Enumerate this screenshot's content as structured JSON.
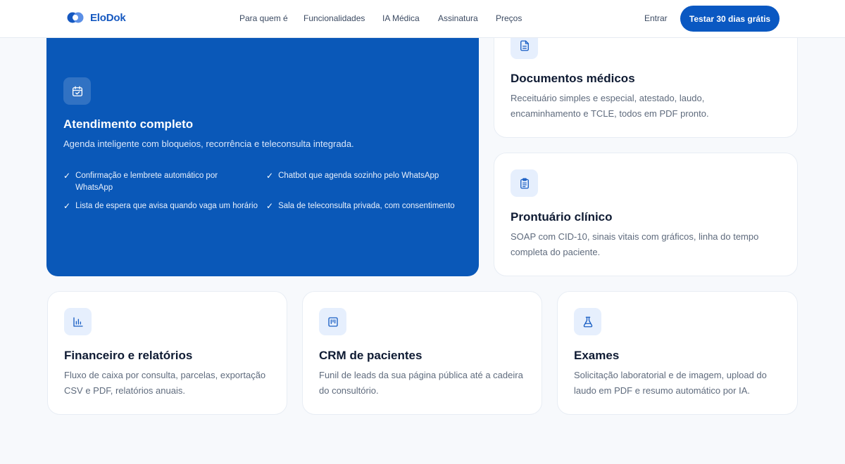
{
  "header": {
    "brand": "EloDok",
    "nav": [
      "Para quem é",
      "Funcionalidades",
      "IA Médica",
      "Assinatura",
      "Preços"
    ],
    "login_label": "Entrar",
    "cta_label": "Testar 30 dias grátis"
  },
  "feature": {
    "icon": "calendar-check-icon",
    "title": "Atendimento completo",
    "description": "Agenda inteligente com bloqueios, recorrência e teleconsulta integrada.",
    "checklist": [
      "Confirmação e lembrete automático por WhatsApp",
      "Chatbot que agenda sozinho pelo WhatsApp",
      "Lista de espera que avisa quando vaga um horário",
      "Sala de teleconsulta privada, com consentimento"
    ]
  },
  "cards": [
    {
      "icon": "document-icon",
      "title": "Documentos médicos",
      "description": "Receituário simples e especial, atestado, laudo, encaminhamento e TCLE, todos em PDF pronto."
    },
    {
      "icon": "clipboard-icon",
      "title": "Prontuário clínico",
      "description": "SOAP com CID-10, sinais vitais com gráficos, linha do tempo completa do paciente."
    },
    {
      "icon": "bar-chart-icon",
      "title": "Financeiro e relatórios",
      "description": "Fluxo de caixa por consulta, parcelas, exportação CSV e PDF, relatórios anuais."
    },
    {
      "icon": "kanban-icon",
      "title": "CRM de pacientes",
      "description": "Funil de leads da sua página pública até a cadeira do consultório."
    },
    {
      "icon": "flask-icon",
      "title": "Exames",
      "description": "Solicitação laboratorial e de imagem, upload do laudo em PDF e resumo automático por IA."
    }
  ],
  "colors": {
    "primary": "#0a58c2",
    "feature_bg": "#0a58b8",
    "icon_bg": "#e6effd",
    "page_bg": "#f7f9fc"
  }
}
